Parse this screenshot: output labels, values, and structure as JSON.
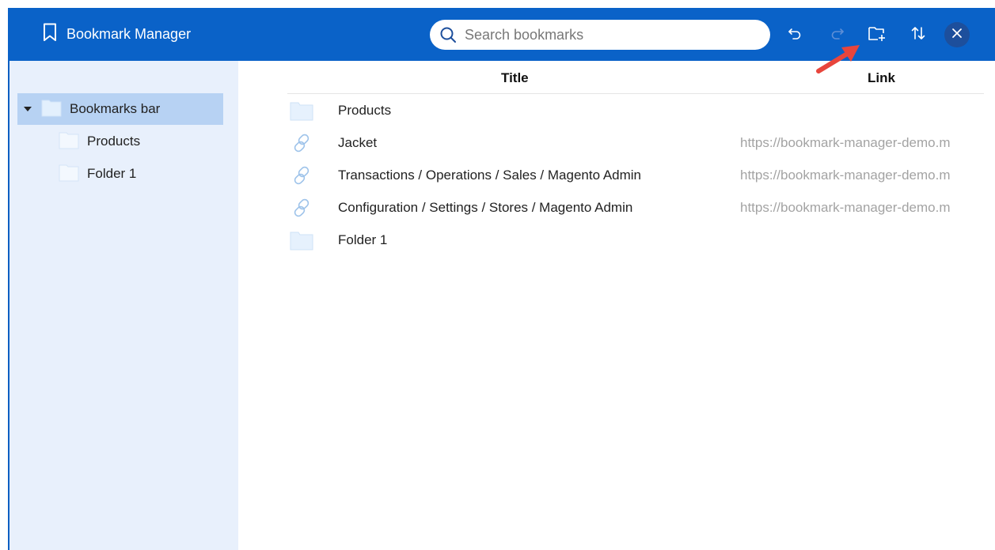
{
  "app": {
    "title": "Bookmark Manager"
  },
  "search": {
    "placeholder": "Search bookmarks"
  },
  "toolbar": {
    "icons": [
      "undo-icon",
      "redo-icon",
      "add-folder-icon",
      "sort-icon",
      "close-icon"
    ]
  },
  "sidebar": {
    "root": {
      "label": "Bookmarks bar",
      "expanded": true
    },
    "children": [
      {
        "label": "Products"
      },
      {
        "label": "Folder 1"
      }
    ]
  },
  "table": {
    "columns": {
      "title": "Title",
      "link": "Link"
    },
    "rows": [
      {
        "type": "folder",
        "title": "Products",
        "link": ""
      },
      {
        "type": "link",
        "title": "Jacket",
        "link": "https://bookmark-manager-demo.m"
      },
      {
        "type": "link",
        "title": "Transactions / Operations / Sales / Magento Admin",
        "link": "https://bookmark-manager-demo.m"
      },
      {
        "type": "link",
        "title": "Configuration / Settings / Stores / Magento Admin",
        "link": "https://bookmark-manager-demo.m"
      },
      {
        "type": "folder",
        "title": "Folder 1",
        "link": ""
      }
    ]
  },
  "colors": {
    "header": "#0a62c8",
    "sidebar": "#e8f0fc",
    "selected": "#b7d2f3",
    "annotation": "#e8453c"
  }
}
